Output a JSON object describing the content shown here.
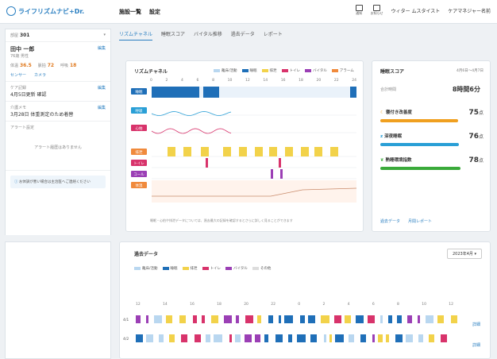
{
  "app": {
    "name": "ライフリズムナビ+Dr."
  },
  "nav": {
    "items": [
      "施設一覧",
      "設定"
    ]
  },
  "top_icons": [
    "通知",
    "お知らせ"
  ],
  "top_dropdowns": [
    "ウィター ムスタイスト",
    "ケアマネジャー名前"
  ],
  "sidebar": {
    "room": "301",
    "room_label": "部屋",
    "patient_name": "田中 一郎",
    "patient_sub": "76歳 男性",
    "edit": "編集",
    "vitals": [
      {
        "label": "体温",
        "value": "36.5"
      },
      {
        "label": "脈拍",
        "value": "72"
      },
      {
        "label": "呼吸",
        "value": "18"
      }
    ],
    "sensor_labels": [
      "センサー",
      "カメラ"
    ],
    "section1_title": "ケア記録",
    "section1_value": "4月5日更新 確認",
    "section2_title": "介護メモ",
    "section2_value": "3月28日 体重測定のため着替",
    "section3_title": "アラート設定",
    "empty": "アラート履歴はありません",
    "notice": "お体調が悪い場合は主治医へご連絡ください"
  },
  "tabs": [
    "リズムチャネル",
    "睡眠スコア",
    "バイタル推移",
    "過去データ",
    "レポート"
  ],
  "rhythm": {
    "title": "リズムチャネル",
    "legend": [
      "離床/活動",
      "睡眠",
      "排泄",
      "トイレ",
      "バイタル",
      "アラーム"
    ],
    "hours": [
      "0",
      "2",
      "4",
      "6",
      "8",
      "10",
      "12",
      "14",
      "16",
      "18",
      "20",
      "22",
      "24"
    ],
    "rows": [
      "睡眠",
      "呼吸",
      "心拍",
      "排泄",
      "トイレ",
      "コール",
      "体温"
    ],
    "footer": "睡眠・心拍や排泄データについては、過去最大の記録を確認するとさらに詳しく見ることができます"
  },
  "score": {
    "title": "睡眠スコア",
    "date": "4月6日〜4月7日",
    "total_label": "合計時間",
    "total_value": "8時間6分",
    "items": [
      {
        "label": "寝付き改善度",
        "value": "75",
        "unit": "点",
        "pct": 0.75,
        "color": "#f0a020"
      },
      {
        "label": "深夜睡眠",
        "value": "76",
        "unit": "点",
        "pct": 0.76,
        "color": "#2a9fd6"
      },
      {
        "label": "熟睡環境指数",
        "value": "78",
        "unit": "点",
        "pct": 0.78,
        "color": "#3aaa3a"
      }
    ],
    "links": [
      "過去データ",
      "月間レポート"
    ]
  },
  "past": {
    "title": "過去データ",
    "month": "2023年4月",
    "legend": [
      "離床/活動",
      "睡眠",
      "排泄",
      "トイレ",
      "バイタル",
      "その他"
    ],
    "hours": [
      "12",
      "14",
      "16",
      "18",
      "20",
      "22",
      "0",
      "2",
      "4",
      "6",
      "8",
      "10",
      "12"
    ],
    "rows": [
      "4/1",
      "4/2"
    ],
    "detail": "詳細"
  },
  "colors": {
    "accent": "#2a7fc1",
    "sleep": "#1f6fb8",
    "purple": "#9b3fb5",
    "pink": "#d8336b",
    "yellow": "#f2d24a",
    "orange": "#f08a3c"
  }
}
